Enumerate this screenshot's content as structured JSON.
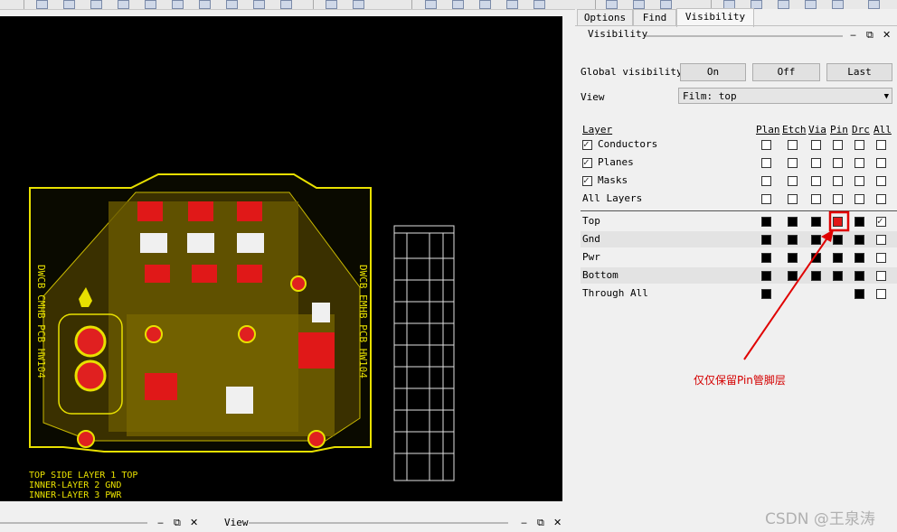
{
  "tabs": [
    "Options",
    "Find",
    "Visibility"
  ],
  "panel": {
    "title": "Visibility",
    "window_controls": [
      "‒",
      "⧉",
      "✕"
    ],
    "global_visibility_label": "Global visibility",
    "buttons": {
      "on": "On",
      "off": "Off",
      "last": "Last"
    },
    "view_label": "View",
    "view_value": "Film: top",
    "layer_header": "Layer",
    "columns": [
      "Plan",
      "Etch",
      "Via",
      "Pin",
      "Drc",
      "All"
    ],
    "groups": [
      {
        "label": "Conductors",
        "checked": true
      },
      {
        "label": "Planes",
        "checked": true
      },
      {
        "label": "Masks",
        "checked": true
      },
      {
        "label": "All Layers",
        "checked": false
      }
    ],
    "layers": [
      {
        "label": "Top",
        "cells": [
          "on",
          "on",
          "on",
          "on",
          "on",
          "check"
        ]
      },
      {
        "label": "Gnd",
        "cells": [
          "on",
          "on",
          "on",
          "on",
          "on",
          "off"
        ]
      },
      {
        "label": "Pwr",
        "cells": [
          "on",
          "on",
          "on",
          "on",
          "on",
          "off"
        ]
      },
      {
        "label": "Bottom",
        "cells": [
          "on",
          "on",
          "on",
          "on",
          "on",
          "off"
        ]
      },
      {
        "label": "Through All",
        "cells": [
          "on",
          "none",
          "none",
          "none",
          "on",
          "off"
        ]
      }
    ],
    "highlighted": {
      "layer": "Top",
      "column": "Pin"
    }
  },
  "annotation": {
    "text": "仅仅保留Pin管脚层",
    "color": "#d40000"
  },
  "canvas": {
    "layer_text": [
      "TOP SIDE LAYER 1 TOP",
      "INNER-LAYER 2 GND",
      "INNER-LAYER 3 PWR"
    ],
    "board_label_left": "DWCB CMHB PCB HW104",
    "board_label_right": "DWCB EMHB PCB HW104"
  },
  "bottom_bar": {
    "view_label": "View",
    "window_controls": [
      "‒",
      "⧉",
      "✕"
    ]
  },
  "watermark": "CSDN @王泉涛"
}
